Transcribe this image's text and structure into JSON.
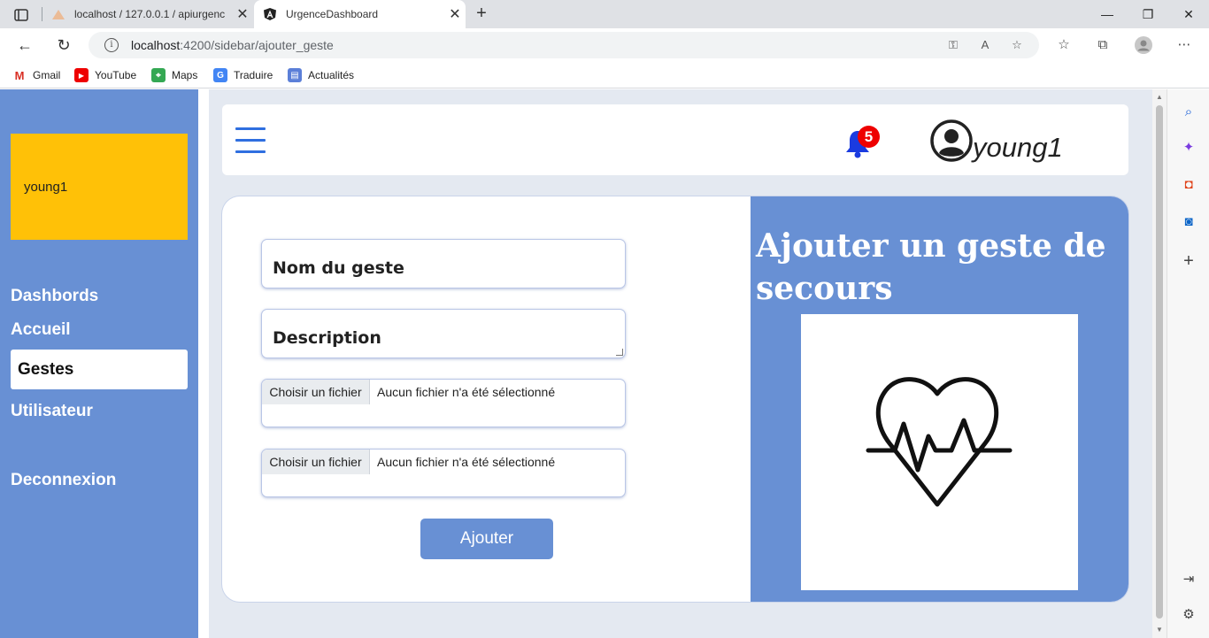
{
  "browser": {
    "tabs": [
      {
        "title": "localhost / 127.0.0.1 / apiurgenc",
        "active": false
      },
      {
        "title": "UrgenceDashboard",
        "active": true
      }
    ],
    "url_host": "localhost",
    "url_path": ":4200/sidebar/ajouter_geste",
    "bookmarks": [
      "Gmail",
      "YouTube",
      "Maps",
      "Traduire",
      "Actualités"
    ]
  },
  "sidebar": {
    "user_name": "young1",
    "links": [
      "Dashbords",
      "Accueil",
      "Gestes",
      "Utilisateur"
    ],
    "active_link": "Gestes",
    "logout": "Deconnexion"
  },
  "header": {
    "notification_count": "5",
    "profile_name": "young1"
  },
  "form": {
    "name_placeholder": "Nom du geste",
    "description_placeholder": "Description",
    "file_inputs": [
      {
        "button": "Choisir un fichier",
        "status": "Aucun fichier n'a été sélectionné"
      },
      {
        "button": "Choisir un fichier",
        "status": "Aucun fichier n'a été sélectionné"
      }
    ],
    "submit_label": "Ajouter"
  },
  "panel": {
    "title": "Ajouter un geste de secours"
  },
  "colors": {
    "primary": "#6890d4",
    "user_card": "#ffc107",
    "badge": "#ee0000",
    "bell": "#1a3be0"
  }
}
